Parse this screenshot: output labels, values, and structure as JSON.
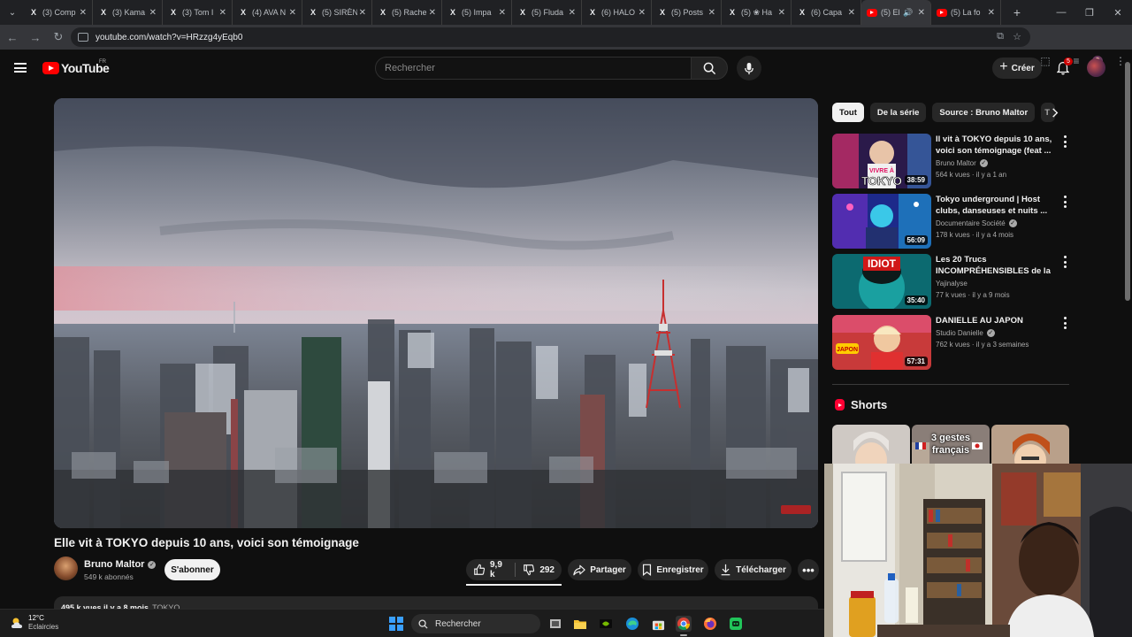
{
  "browser": {
    "tabs": [
      {
        "label": "(3) Comp",
        "favicon": "x-logo-icon"
      },
      {
        "label": "(3) Kama",
        "favicon": "x-logo-icon"
      },
      {
        "label": "(3) Tom I",
        "favicon": "x-logo-icon"
      },
      {
        "label": "(4) AVA N",
        "favicon": "x-logo-icon"
      },
      {
        "label": "(5) SIRÈN",
        "favicon": "x-logo-icon"
      },
      {
        "label": "(5) Rache",
        "favicon": "x-logo-icon"
      },
      {
        "label": "(5) Impa",
        "favicon": "x-logo-icon"
      },
      {
        "label": "(5) Fluda",
        "favicon": "x-logo-icon"
      },
      {
        "label": "(6) HALO",
        "favicon": "x-logo-icon"
      },
      {
        "label": "(5) Posts",
        "favicon": "x-logo-icon"
      },
      {
        "label": "(5) ❀ Ha",
        "favicon": "x-logo-icon"
      },
      {
        "label": "(6) Capa",
        "favicon": "x-logo-icon"
      },
      {
        "label": "(5) El",
        "favicon": "youtube-icon",
        "active": true,
        "playing_audio": true
      },
      {
        "label": "(5) La fo",
        "favicon": "youtube-icon"
      }
    ],
    "url": "youtube.com/watch?v=HRzzg4yEqb0"
  },
  "youtube": {
    "logo_text": "YouTube",
    "country_code": "FR",
    "search_placeholder": "Rechercher",
    "create_label": "Créer",
    "notification_count": "5"
  },
  "video": {
    "title": "Elle vit à TOKYO depuis 10 ans, voici son témoignage",
    "channel": "Bruno Maltor",
    "subscribers": "549 k abonnés",
    "subscribe_label": "S'abonner",
    "likes": "9,9 k",
    "dislikes": "292",
    "share_label": "Partager",
    "save_label": "Enregistrer",
    "download_label": "Télécharger",
    "description_line": "495 k vues  il y a 8 mois",
    "description_tag": "TOKYO"
  },
  "chips": [
    "Tout",
    "De la série",
    "Source : Bruno Maltor",
    "T"
  ],
  "recommendations": [
    {
      "title": "Il vit à TOKYO depuis 10 ans, voici son témoignage (feat ...",
      "channel": "Bruno Maltor",
      "verified": true,
      "meta": "564 k vues · il y a 1 an",
      "duration": "38:59"
    },
    {
      "title": "Tokyo underground | Host clubs, danseuses et nuits ...",
      "channel": "Documentaire Société",
      "verified": true,
      "meta": "178 k vues · il y a 4 mois",
      "duration": "56:09"
    },
    {
      "title": "Les 20 Trucs INCOMPRÉHENSIBLES de la ...",
      "channel": "Yajinalyse",
      "verified": false,
      "meta": "77 k vues · il y a 9 mois",
      "duration": "35:40"
    },
    {
      "title": "DANIELLE AU JAPON",
      "channel": "Studio Danielle",
      "verified": true,
      "meta": "762 k vues · il y a 3 semaines",
      "duration": "57:31"
    }
  ],
  "thumb_text": {
    "rec1_a": "VIVRE À",
    "rec1_b": "TOKYO",
    "rec3": "IDIOT",
    "rec4": "JAPON"
  },
  "shorts": {
    "heading": "Shorts",
    "items": [
      {
        "text": ""
      },
      {
        "text": "3 gestes français"
      },
      {
        "text": ""
      }
    ]
  },
  "taskbar": {
    "temperature": "12°C",
    "condition": "Eclaircies",
    "search_label": "Rechercher"
  },
  "colors": {
    "background": "#0f0f0f",
    "accent_red": "#ff0000",
    "chip_bg": "#272727"
  }
}
